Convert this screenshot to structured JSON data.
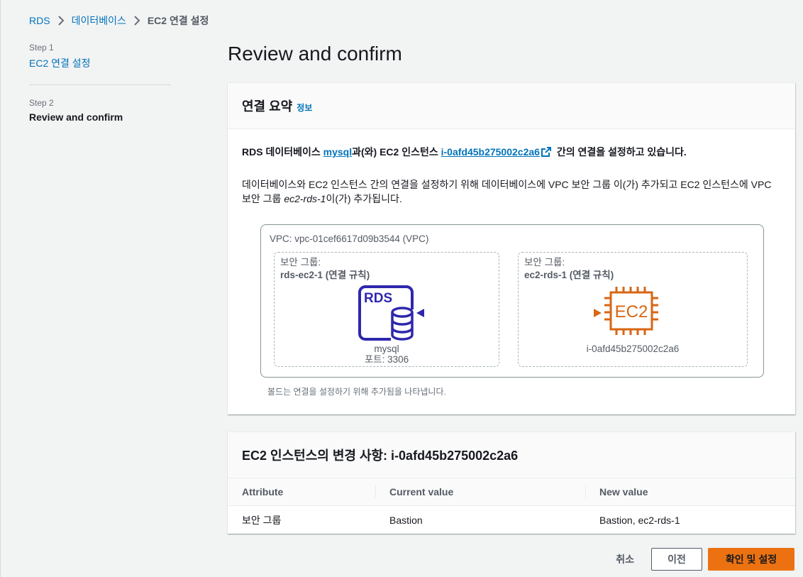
{
  "breadcrumb": {
    "items": [
      "RDS",
      "데이터베이스"
    ],
    "current": "EC2 연결 설정"
  },
  "steps": [
    {
      "label": "Step 1",
      "title": "EC2 연결 설정"
    },
    {
      "label": "Step 2",
      "title": "Review and confirm"
    }
  ],
  "page_title": "Review and confirm",
  "summary": {
    "title": "연결 요약",
    "info": "정보",
    "line1": {
      "prefix": "RDS 데이터베이스 ",
      "db_link": "mysql",
      "middle": "과(와) EC2 인스턴스 ",
      "instance_link": "i-0afd45b275002c2a6",
      "suffix": " 간의 연결을 설정하고 있습니다."
    },
    "line2": {
      "prefix": "데이터베이스와 EC2 인스턴스 간의 연결을 설정하기 위해 데이터베이스에 VPC 보안 그룹 이(가) 추가되고 EC2 인스턴스에 VPC 보안 그룹 ",
      "sg_name": "ec2-rds-1",
      "suffix": "이(가) 추가됩니다."
    },
    "diagram": {
      "vpc": "VPC: vpc-01cef6617d09b3544 (VPC)",
      "left_sg": {
        "caption": "보안 그룹:",
        "name": "rds-ec2-1 (연결 규칙)",
        "icon_text": "RDS",
        "resource": "mysql",
        "port": "포트: 3306"
      },
      "right_sg": {
        "caption": "보안 그룹:",
        "name": "ec2-rds-1 (연결 규칙)",
        "icon_text": "EC2",
        "resource": "i-0afd45b275002c2a6"
      }
    },
    "note": "볼드는 연결을 설정하기 위해 추가됨을 나타냅니다."
  },
  "changes": {
    "title": "EC2 인스턴스의 변경 사항: i-0afd45b275002c2a6",
    "columns": [
      "Attribute",
      "Current value",
      "New value"
    ],
    "rows": [
      [
        "보안 그룹",
        "Bastion",
        "Bastion, ec2-rds-1"
      ]
    ]
  },
  "footer": {
    "cancel": "취소",
    "previous": "이전",
    "confirm": "확인 및 설정"
  },
  "colors": {
    "link": "#0073bb",
    "primary": "#ec7211",
    "rds_icon": "#2e27ad",
    "ec2_icon": "#d86613"
  }
}
